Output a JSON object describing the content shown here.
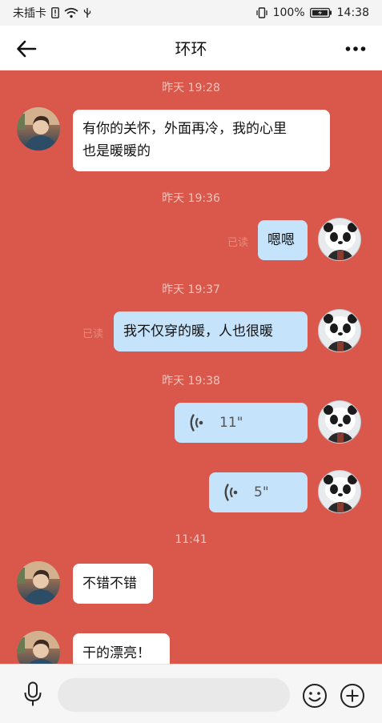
{
  "status_bar": {
    "carrier": "未插卡",
    "battery": "100%",
    "time": "14:38"
  },
  "header": {
    "title": "环环"
  },
  "messages": [
    {
      "type": "time",
      "text": "昨天 19:28"
    },
    {
      "type": "text",
      "side": "in",
      "lines": [
        "有你的关怀，外面再冷，我的心里",
        "也是暖暖的"
      ]
    },
    {
      "type": "time",
      "text": "昨天 19:36"
    },
    {
      "type": "text",
      "side": "out",
      "text": "嗯嗯",
      "status": "已读"
    },
    {
      "type": "time",
      "text": "昨天 19:37"
    },
    {
      "type": "text",
      "side": "out",
      "text": "我不仅穿的暖，人也很暖",
      "status": "已读"
    },
    {
      "type": "time",
      "text": "昨天 19:38"
    },
    {
      "type": "voice",
      "side": "out",
      "duration": "11\""
    },
    {
      "type": "voice",
      "side": "out",
      "duration": "5\""
    },
    {
      "type": "time",
      "text": "11:41"
    },
    {
      "type": "text",
      "side": "in",
      "text": "不错不错"
    },
    {
      "type": "text",
      "side": "in",
      "text": "干的漂亮！"
    }
  ],
  "input": {
    "value": "",
    "placeholder": ""
  },
  "icons": {
    "back": "arrow-left-icon",
    "more": "more-dots-icon",
    "mic": "microphone-icon",
    "emoji": "emoji-icon",
    "plus": "plus-icon",
    "voice": "voice-wave-icon"
  },
  "colors": {
    "chat_background": "#d9584b",
    "incoming_bubble": "#ffffff",
    "outgoing_bubble": "#c5e3fb",
    "timestamp": "#f4c4bd"
  }
}
